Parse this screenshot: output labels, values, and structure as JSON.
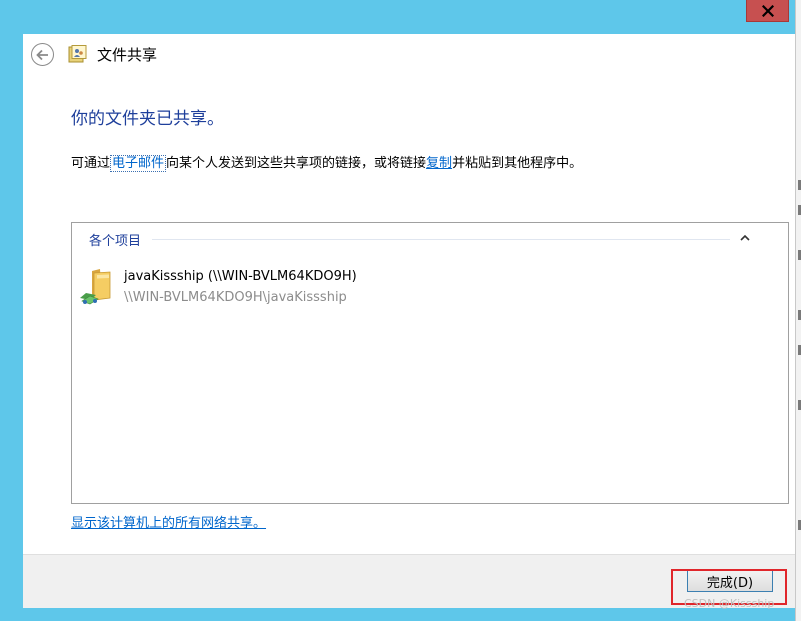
{
  "window": {
    "close_glyph": "✕",
    "nav_title": "文件共享"
  },
  "content": {
    "heading": "你的文件夹已共享。",
    "desc_part1": "可通过",
    "desc_link_email": "电子邮件",
    "desc_part2": "向某个人发送到这些共享项的链接，或将链接",
    "desc_link_copy": "复制",
    "desc_part3": "并粘贴到其他程序中。",
    "group_label": "各个项目",
    "items": [
      {
        "name": "javaKissship (\\\\WIN-BVLM64KDO9H)",
        "path": "\\\\WIN-BVLM64KDO9H\\javaKissship"
      }
    ],
    "show_all_link": "显示该计算机上的所有网络共享。"
  },
  "footer": {
    "finish_label": "完成(D)"
  },
  "watermark": "CSDN @Kissship",
  "colors": {
    "window_frame": "#5ec7ea",
    "heading": "#1e3f9b",
    "link": "#0066cc",
    "close_button": "#c75050",
    "highlight": "#e0262b"
  },
  "icons": {
    "close": "close-icon",
    "back": "back-arrow-icon",
    "share": "file-share-icon",
    "collapse": "chevron-up-icon",
    "folder": "shared-folder-icon"
  }
}
